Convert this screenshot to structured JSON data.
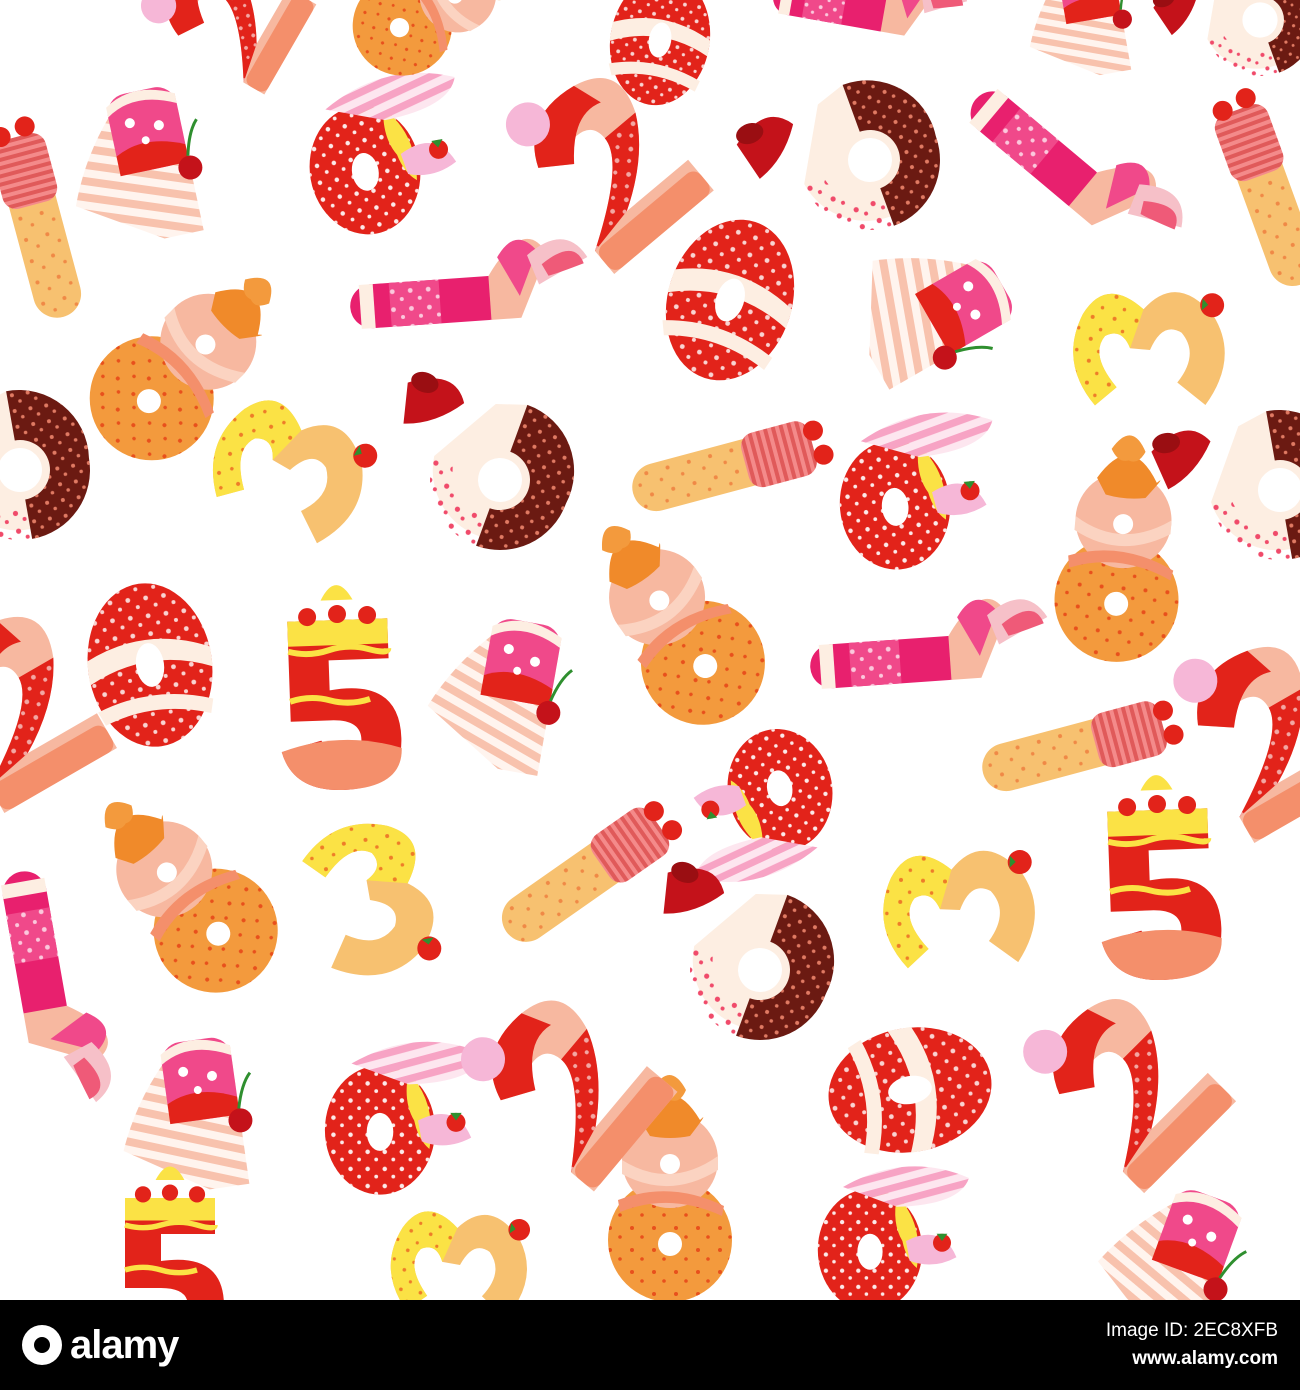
{
  "banner": {
    "logo_text": "alamy",
    "image_id_label": "Image ID: 2EC8XFB",
    "url": "www.alamy.com"
  },
  "palette": {
    "red": "#e2231a",
    "dark_red": "#b3141c",
    "pink": "#f0498a",
    "hot_pink": "#e8206e",
    "peach": "#f7b8a0",
    "orange": "#f39a3d",
    "light_orange": "#f7c170",
    "yellow": "#fbe245",
    "chocolate": "#6b1a12",
    "cream": "#fdeee2",
    "cherry": "#c4121a"
  }
}
